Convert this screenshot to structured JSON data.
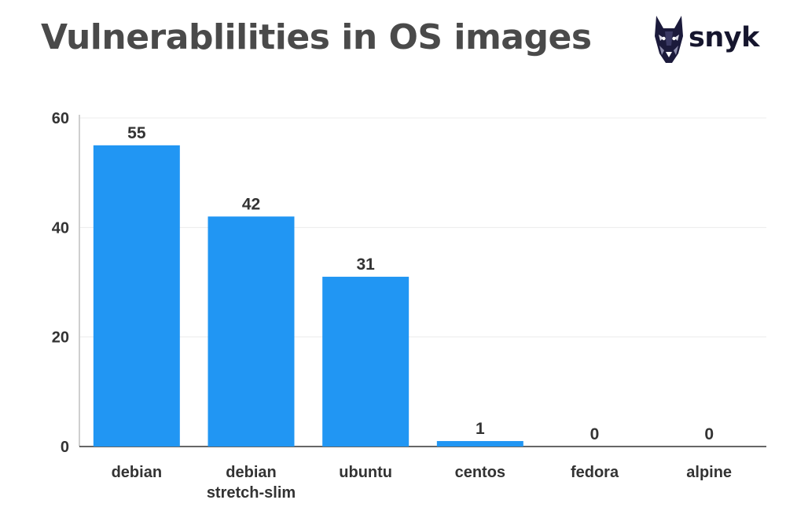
{
  "chart_data": {
    "type": "bar",
    "title": "Vulnerablilities in OS images",
    "categories": [
      "debian",
      "debian\nstretch-slim",
      "ubuntu",
      "centos",
      "fedora",
      "alpine"
    ],
    "series": [
      {
        "values": [
          55,
          42,
          31,
          1,
          0,
          0
        ]
      }
    ],
    "data_labels": [
      "55",
      "42",
      "31",
      "1",
      "0",
      "0"
    ],
    "yticks": [
      0,
      20,
      40,
      60
    ],
    "ylim": [
      0,
      60
    ],
    "xlabel": "",
    "ylabel": "",
    "grid": true,
    "legend": "none",
    "bar_color": "#2196f3"
  },
  "brand": {
    "logo_text": "snyk",
    "logo_icon": "doberman-dog-icon"
  }
}
